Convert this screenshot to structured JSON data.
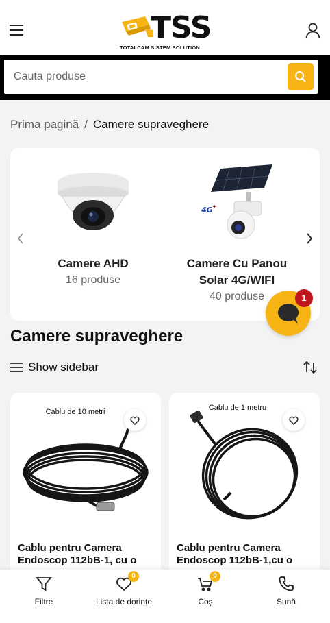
{
  "header": {
    "logo_text": "TSS",
    "logo_subtitle": "TOTALCAM SISTEM SOLUTION"
  },
  "search": {
    "placeholder": "Cauta produse"
  },
  "breadcrumb": {
    "home": "Prima pagină",
    "separator": "/",
    "current": "Camere supraveghere"
  },
  "categories": [
    {
      "title": "Camere AHD",
      "count": "16 produse",
      "icon": "dome-camera-image"
    },
    {
      "title": "Camere Cu Panou Solar 4G/WIFI",
      "count": "40 produse",
      "icon": "solar-camera-image"
    }
  ],
  "chat": {
    "badge": "1"
  },
  "section": {
    "title": "Camere supraveghere",
    "sidebar_toggle": "Show sidebar"
  },
  "products": [
    {
      "tag": "Cablu de 10 metri",
      "title": "Cablu pentru Camera Endoscop 112bB-1, cu o"
    },
    {
      "tag": "Cablu de 1 metru",
      "title": "Cablu pentru Camera Endoscop 112bB-1,cu o"
    }
  ],
  "bottom_bar": {
    "filters": "Filtre",
    "wishlist": "Lista de dorințe",
    "wishlist_count": "0",
    "cart": "Coș",
    "cart_count": "0",
    "call": "Sună"
  },
  "colors": {
    "accent": "#f7b515",
    "badge_red": "#c0171d",
    "search_band": "#000000"
  }
}
